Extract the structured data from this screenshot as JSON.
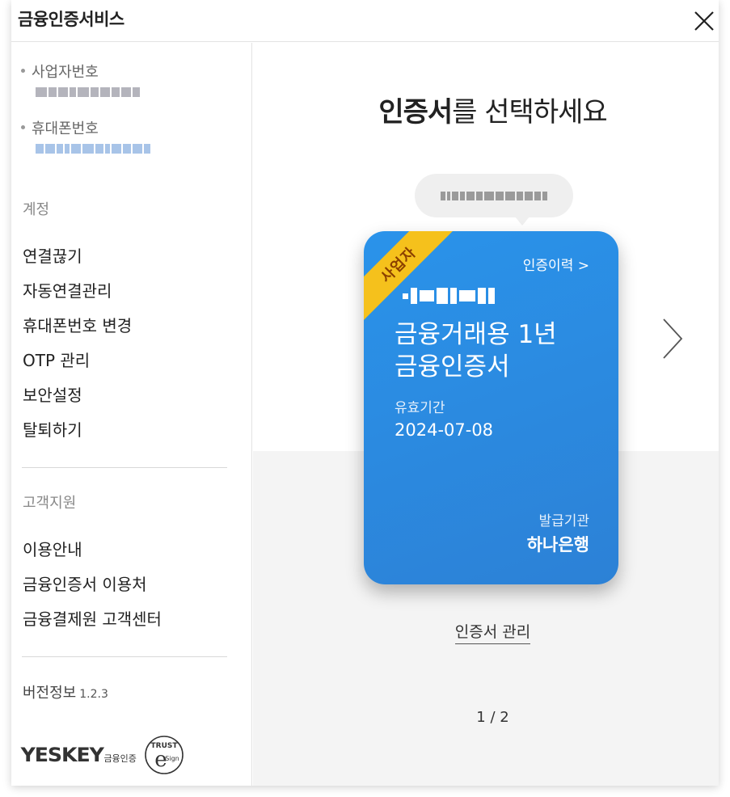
{
  "app": {
    "title": "금융인증서비스"
  },
  "sidebar": {
    "business_number_label": "사업자번호",
    "phone_number_label": "휴대폰번호",
    "account_section": "계정",
    "account_items": [
      "연결끊기",
      "자동연결관리",
      "휴대폰번호 변경",
      "OTP 관리",
      "보안설정",
      "탈퇴하기"
    ],
    "support_section": "고객지원",
    "support_items": [
      "이용안내",
      "금융인증서 이용처",
      "금융결제원 고객센터"
    ],
    "version_label": "버전정보",
    "version_number": "1.2.3",
    "logo_text": "YESKEY",
    "logo_sub": "금융인증",
    "trust_logo_text_top": "TRUST",
    "trust_logo_text_bottom": "Sign"
  },
  "main": {
    "heading_bold": "인증서",
    "heading_rest": "를 선택하세요",
    "card": {
      "badge": "사업자",
      "history_link": "인증이력 >",
      "name_line1": "금융거래용 1년",
      "name_line2": "금융인증서",
      "valid_label": "유효기간",
      "valid_date": "2024-07-08",
      "issuer_label": "발급기관",
      "issuer_name": "하나은행"
    },
    "manage_link": "인증서 관리",
    "pager": "1 / 2"
  },
  "colors": {
    "card_blue": "#2a8ae3",
    "ribbon_yellow": "#f5c11c",
    "bottom_gray": "#f4f4f4"
  },
  "icons": {
    "close": "close-icon",
    "next": "chevron-right-icon"
  }
}
